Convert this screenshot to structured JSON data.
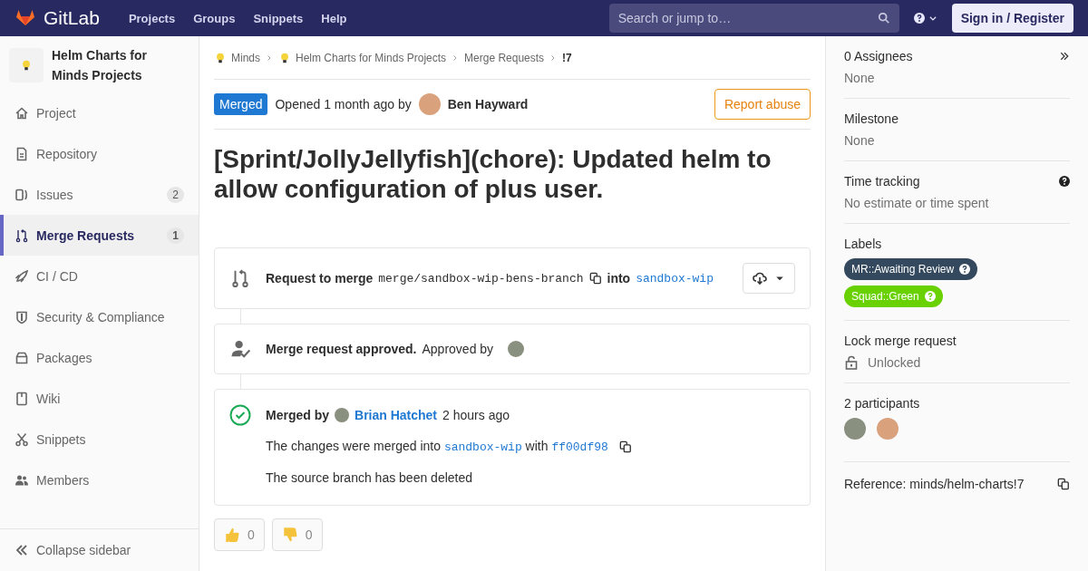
{
  "header": {
    "logo_text": "GitLab",
    "nav": [
      "Projects",
      "Groups",
      "Snippets",
      "Help"
    ],
    "search": {
      "placeholder": "Search or jump to…"
    },
    "sign_in": "Sign in / Register"
  },
  "sidebar": {
    "project_name": "Helm Charts for Minds Projects",
    "items": [
      {
        "label": "Project",
        "selected": false
      },
      {
        "label": "Repository",
        "selected": false
      },
      {
        "label": "Issues",
        "count": "2",
        "selected": false
      },
      {
        "label": "Merge Requests",
        "count": "1",
        "selected": true
      },
      {
        "label": "CI / CD",
        "selected": false
      },
      {
        "label": "Security & Compliance",
        "selected": false
      },
      {
        "label": "Packages",
        "selected": false
      },
      {
        "label": "Wiki",
        "selected": false
      },
      {
        "label": "Snippets",
        "selected": false
      },
      {
        "label": "Members",
        "selected": false
      }
    ],
    "collapse": "Collapse sidebar"
  },
  "breadcrumbs": [
    {
      "label": "Minds",
      "kind": "project"
    },
    {
      "label": "Helm Charts for Minds Projects",
      "kind": "project"
    },
    {
      "label": "Merge Requests",
      "kind": "page"
    },
    {
      "label": "!7",
      "kind": "current"
    }
  ],
  "status": {
    "badge": "Merged",
    "opened": "Opened 1 month ago by",
    "author": "Ben Hayward",
    "report": "Report abuse"
  },
  "title": "[Sprint/JollyJellyfish](chore): Updated helm to allow configuration of plus user.",
  "merge_request": {
    "label": "Request to merge",
    "source": "merge/sandbox-wip-bens-branch",
    "into": "into",
    "target": "sandbox-wip"
  },
  "approval": {
    "bold": "Merge request approved.",
    "text": "Approved by"
  },
  "merged": {
    "bold": "Merged by",
    "user": "Brian Hatchet",
    "time": "2 hours ago",
    "changes": "The changes were merged into",
    "branch": "sandbox-wip",
    "with": "with",
    "sha": "ff00df98",
    "deleted": "The source branch has been deleted"
  },
  "reactions": [
    {
      "kind": "thumbs-up",
      "count": "0"
    },
    {
      "kind": "thumbs-down",
      "count": "0"
    }
  ],
  "right": {
    "assignees": {
      "title": "0 Assignees",
      "value": "None"
    },
    "milestone": {
      "title": "Milestone",
      "value": "None"
    },
    "time_tracking": {
      "title": "Time tracking",
      "value": "No estimate or time spent"
    },
    "labels": {
      "title": "Labels",
      "items": [
        {
          "text": "MR::Awaiting Review",
          "color": "#34495e"
        },
        {
          "text": "Squad::Green",
          "color": "#69d100"
        }
      ]
    },
    "lock": {
      "title": "Lock merge request",
      "value": "Unlocked"
    },
    "participants": {
      "title": "2 participants"
    },
    "reference": "Reference: minds/helm-charts!7"
  }
}
